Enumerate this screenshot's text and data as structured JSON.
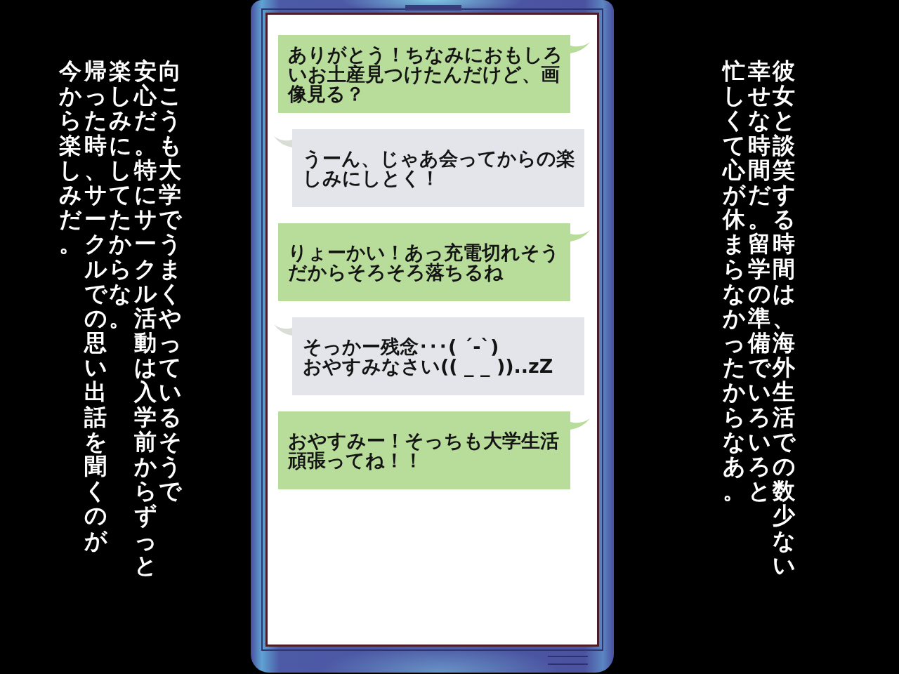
{
  "narration_left": {
    "lines": [
      "今から楽しみだ。",
      "帰った時、サークルでの思い出話を聞くのが",
      "楽しみにしてたからな。",
      "安心だ。特にサークル活動は入学前からずっと",
      "向こうも大学でうまくやっているそうで"
    ]
  },
  "phone": {
    "messages": [
      {
        "kind": "sent",
        "text": "ありがとう！ちなみにおもしろいお土産見つけたんだけど、画像見る？"
      },
      {
        "kind": "received",
        "text": "うーん、じゃあ会ってからの楽しみにしとく！"
      },
      {
        "kind": "sent",
        "text": "りょーかい！あっ充電切れそうだからそろそろ落ちるね"
      },
      {
        "kind": "received",
        "text": "そっかー残念･･･( ´-`)\nおやすみなさい(( _ _ ))..zZ"
      },
      {
        "kind": "sent",
        "text": "おやすみー！そっちも大学生活頑張ってね！！"
      }
    ]
  },
  "narration_right": {
    "lines": [
      "忙しくて心が休まらなかったからなあ。",
      "幸せな時間だ。留学の準備でいろいろと",
      "彼女と談笑する時間は、海外生活での数少ない"
    ]
  }
}
